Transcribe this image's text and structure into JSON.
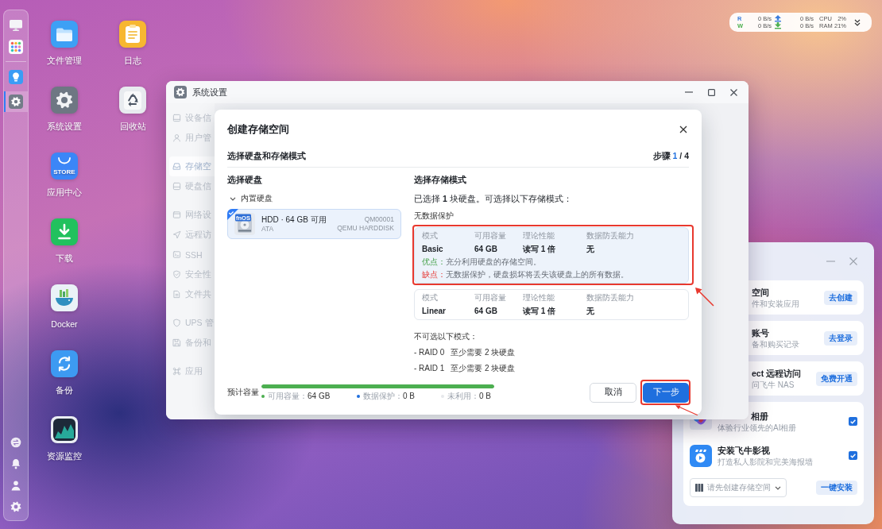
{
  "dock": {
    "apps": [
      {
        "selected": false
      },
      {
        "selected": false
      },
      {
        "selected": false
      },
      {
        "selected": true
      }
    ]
  },
  "desktop_icons": [
    {
      "label": "文件管理"
    },
    {
      "label": "系统设置"
    },
    {
      "label": "应用中心",
      "icon_text": "STORE"
    },
    {
      "label": "下载"
    },
    {
      "label": "Docker"
    },
    {
      "label": "备份"
    },
    {
      "label": "资源监控"
    },
    {
      "label": "日志"
    },
    {
      "label": "回收站"
    }
  ],
  "system_monitor": {
    "rows": [
      {
        "label": "R",
        "color": "#3b7ddd",
        "rate_1": "0 B/s",
        "rate_2": "0 B/s",
        "metric": "CPU",
        "value": "2%"
      },
      {
        "label": "W",
        "color": "#4caf50",
        "rate_1": "0 B/s",
        "rate_2": "0 B/s",
        "metric": "RAM",
        "value": "21%"
      }
    ]
  },
  "settings_window": {
    "title": "系统设置",
    "sidebar": {
      "groups": [
        {
          "items": [
            {
              "label": "设备信",
              "selected": false
            },
            {
              "label": "用户管",
              "selected": false
            }
          ]
        },
        {
          "items": [
            {
              "label": "存储空",
              "selected": true
            },
            {
              "label": "硬盘信",
              "selected": false
            }
          ]
        },
        {
          "items": [
            {
              "label": "网络设",
              "selected": false
            },
            {
              "label": "远程访",
              "selected": false
            },
            {
              "label": "SSH",
              "selected": false
            },
            {
              "label": "安全性",
              "selected": false
            },
            {
              "label": "文件共",
              "selected": false
            }
          ]
        },
        {
          "items": [
            {
              "label": "UPS 管",
              "selected": false
            },
            {
              "label": "备份和",
              "selected": false
            }
          ]
        },
        {
          "items": [
            {
              "label": "应用",
              "selected": false
            }
          ]
        }
      ]
    }
  },
  "dialog": {
    "title": "创建存储空间",
    "subtitle": "选择硬盘和存储模式",
    "step": {
      "label": "步骤",
      "current": "1",
      "total": "/ 4"
    },
    "disks": {
      "title": "选择硬盘",
      "group": "内置硬盘",
      "expanded": true,
      "items": [
        {
          "name": "HDD · 64 GB 可用",
          "interface": "ATA",
          "serial": "QM00001",
          "model": "QEMU HARDDISK",
          "icon_text": "fnOS",
          "selected": true
        }
      ]
    },
    "modes": {
      "title": "选择存储模式",
      "summary": "已选择 **1** 块硬盘。可选择以下存储模式：",
      "group": "无数据保护",
      "items": [
        {
          "headers": [
            "模式",
            "可用容量",
            "理论性能",
            "数据防丢能力"
          ],
          "values": [
            "Basic",
            "64 GB",
            "读写 1 倍",
            "无"
          ],
          "notes": [
            {
              "kind": "pro",
              "label": "优点：",
              "text": "充分利用硬盘的存储空间。"
            },
            {
              "kind": "con",
              "label": "缺点：",
              "text": "无数据保护，硬盘损坏将丢失该硬盘上的所有数据。"
            }
          ],
          "selected": true,
          "highlighted": true
        },
        {
          "headers": [
            "模式",
            "可用容量",
            "理论性能",
            "数据防丢能力"
          ],
          "values": [
            "Linear",
            "64 GB",
            "读写 1 倍",
            "无"
          ],
          "selected": false,
          "highlighted": false
        }
      ],
      "unavailable_title": "不可选以下模式：",
      "unavailable": [
        {
          "name": "- RAID 0",
          "requirement": "至少需要 2 块硬盘"
        },
        {
          "name": "- RAID 1",
          "requirement": "至少需要 2 块硬盘"
        }
      ]
    },
    "footer": {
      "capacity_label": "预计容量",
      "capacity_bar": {
        "level": 1
      },
      "legend": [
        {
          "label": "可用容量：",
          "value": "64 GB",
          "color": "#4caf50"
        },
        {
          "label": "数据保护：",
          "value": "0 B",
          "color": "#1f6fde"
        },
        {
          "label": "未利用：",
          "value": "0 B",
          "color": "#e6e8eb"
        }
      ],
      "buttons": [
        {
          "label": "取消",
          "kind": "secondary",
          "highlighted": false
        },
        {
          "label": "下一步",
          "kind": "primary",
          "highlighted": true
        }
      ]
    }
  },
  "setup_panel": {
    "tasks": [
      {
        "title": "空间",
        "subtitle": "件和安装应用",
        "action": "去创建"
      },
      {
        "title": "账号",
        "subtitle": "备和购买记录",
        "action": "去登录"
      },
      {
        "title": "ect 远程访问",
        "subtitle": "问飞牛 NAS",
        "action": "免费开通"
      }
    ],
    "apps": [
      {
        "title": "相册",
        "subtitle": "体验行业领先的AI相册",
        "checked": true
      },
      {
        "title": "安装飞牛影视",
        "subtitle": "打造私人影院和完美海报墙",
        "checked": true
      }
    ],
    "storage_select": {
      "placeholder": "请先创建存储空间"
    },
    "install_button": "一键安装"
  }
}
